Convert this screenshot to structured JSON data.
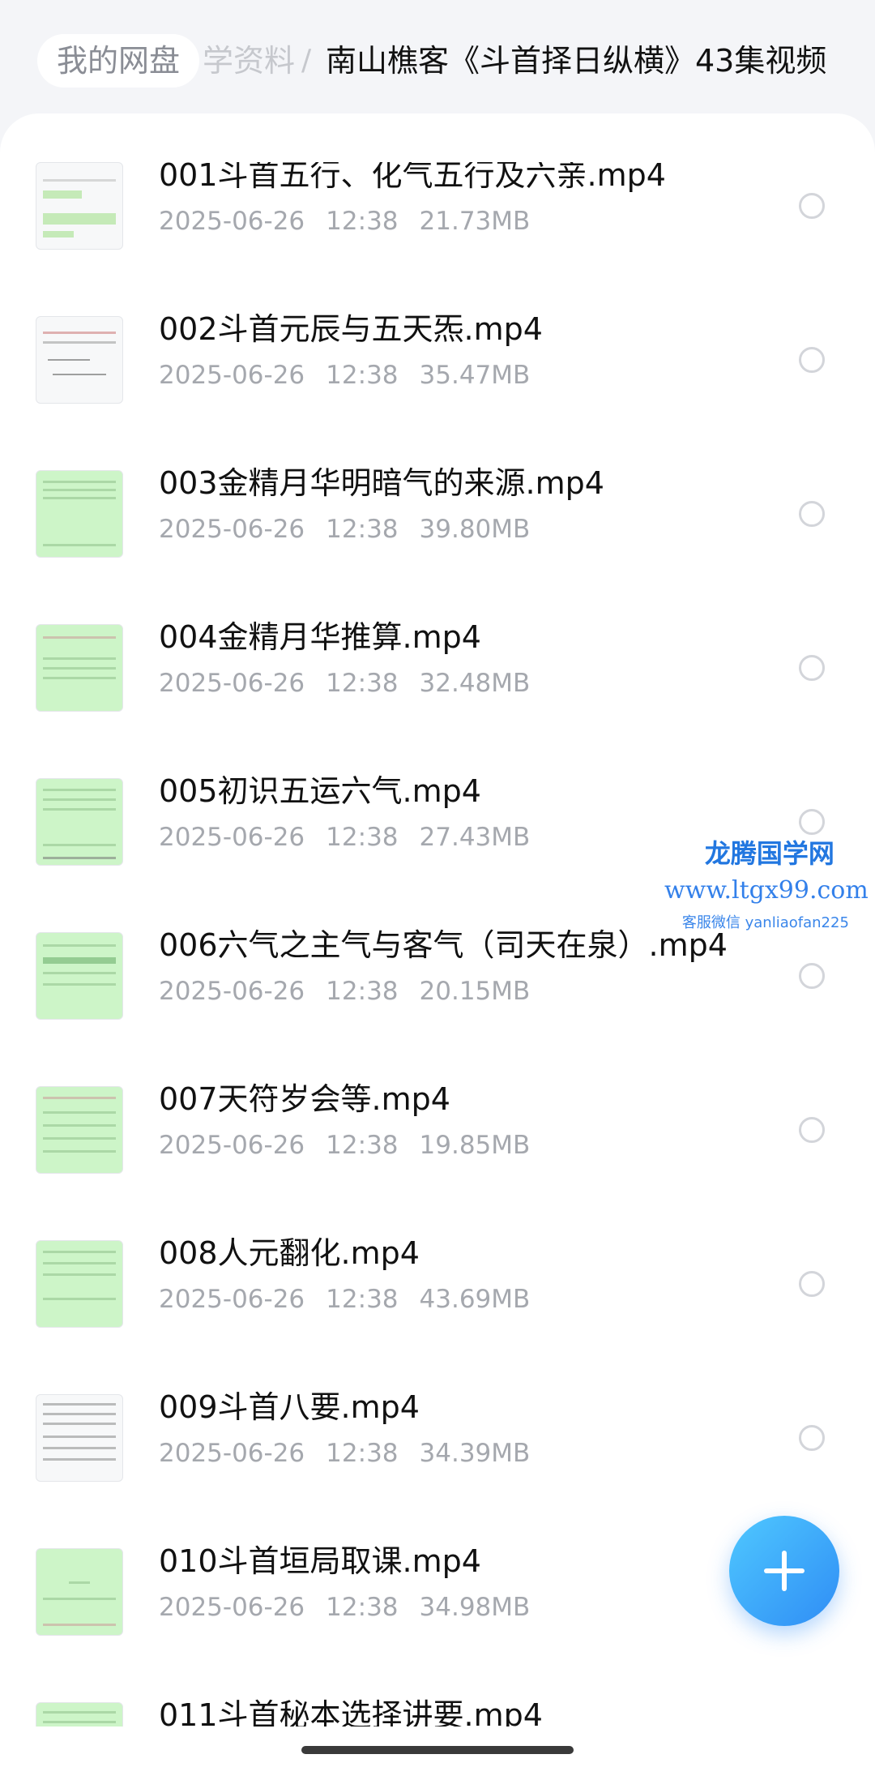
{
  "breadcrumb": {
    "root": "我的网盘",
    "middle": "学资料",
    "separator": "/",
    "current": "南山樵客《斗首择日纵横》43集视频"
  },
  "files": [
    {
      "name": "001斗首五行、化气五行及六亲.mp4",
      "date": "2025-06-26",
      "time": "12:38",
      "size": "21.73MB"
    },
    {
      "name": "002斗首元辰与五天炁.mp4",
      "date": "2025-06-26",
      "time": "12:38",
      "size": "35.47MB"
    },
    {
      "name": "003金精月华明暗气的来源.mp4",
      "date": "2025-06-26",
      "time": "12:38",
      "size": "39.80MB"
    },
    {
      "name": "004金精月华推算.mp4",
      "date": "2025-06-26",
      "time": "12:38",
      "size": "32.48MB"
    },
    {
      "name": "005初识五运六气.mp4",
      "date": "2025-06-26",
      "time": "12:38",
      "size": "27.43MB"
    },
    {
      "name": "006六气之主气与客气（司天在泉）.mp4",
      "date": "2025-06-26",
      "time": "12:38",
      "size": "20.15MB"
    },
    {
      "name": "007天符岁会等.mp4",
      "date": "2025-06-26",
      "time": "12:38",
      "size": "19.85MB"
    },
    {
      "name": "008人元翻化.mp4",
      "date": "2025-06-26",
      "time": "12:38",
      "size": "43.69MB"
    },
    {
      "name": "009斗首八要.mp4",
      "date": "2025-06-26",
      "time": "12:38",
      "size": "34.39MB"
    },
    {
      "name": "010斗首垣局取课.mp4",
      "date": "2025-06-26",
      "time": "12:38",
      "size": "34.98MB"
    },
    {
      "name": "011斗首秘本选择讲要.mp4",
      "date": "",
      "time": "",
      "size": ""
    }
  ],
  "watermark": {
    "line1": "龙腾国学网",
    "line2": "www.ltgx99.com",
    "line3": "客服微信 yanliaofan225"
  },
  "fab": {
    "icon": "plus-icon"
  }
}
